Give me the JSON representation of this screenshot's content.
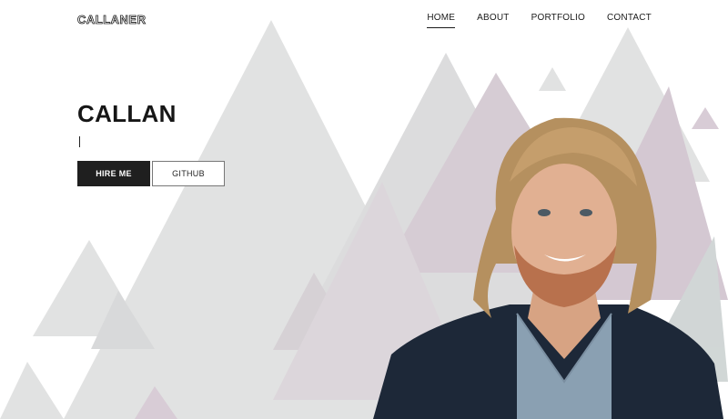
{
  "header": {
    "logo": "CALLANER",
    "nav": [
      {
        "label": "HOME",
        "active": true
      },
      {
        "label": "ABOUT",
        "active": false
      },
      {
        "label": "PORTFOLIO",
        "active": false
      },
      {
        "label": "CONTACT",
        "active": false
      }
    ]
  },
  "hero": {
    "title": "CALLAN",
    "hire_button": "HIRE ME",
    "github_button": "GITHUB"
  },
  "colors": {
    "text_dark": "#161616",
    "button_dark": "#1f1f1f",
    "triangle_gray": "#d9dadb",
    "triangle_purple": "#cbbfca",
    "jacket": "#1e2a3a"
  }
}
